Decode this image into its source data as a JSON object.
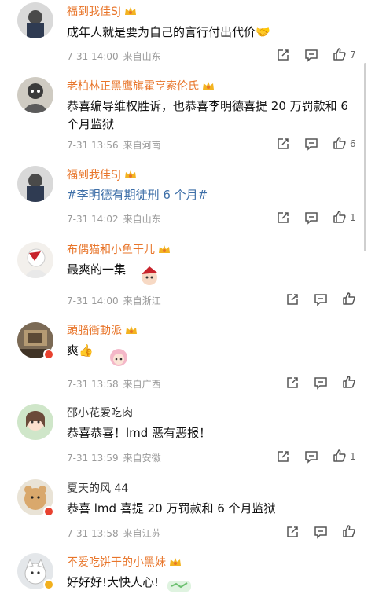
{
  "comments": [
    {
      "name": "福到我佳SJ",
      "text": "成年人就是要为自己的言行付出代价",
      "time": "7-31 14:00",
      "location": "来自山东",
      "likes": "7"
    },
    {
      "name": "老柏林正黑鹰旗霍亨索伦氏",
      "text": "恭喜编导维权胜诉，也恭喜李明德喜提 20 万罚款和 6 个月监狱",
      "time": "7-31 13:56",
      "location": "来自河南",
      "likes": "6"
    },
    {
      "name": "福到我佳SJ",
      "text": "#李明德有期徒刑 6 个月#",
      "time": "7-31 14:02",
      "location": "来自山东",
      "likes": "1"
    },
    {
      "name": "布偶猫和小鱼干儿",
      "text": "最爽的一集",
      "time": "7-31 14:00",
      "location": "来自浙江",
      "likes": ""
    },
    {
      "name": "頭腦衝動派",
      "text": "爽",
      "time": "7-31 13:58",
      "location": "来自广西",
      "likes": ""
    },
    {
      "name": "邵小花爱吃肉",
      "text": "恭喜恭喜！lmd 恶有恶报！",
      "time": "7-31 13:59",
      "location": "来自安徽",
      "likes": "1"
    },
    {
      "name": "夏天的风 44",
      "text": "恭喜 lmd 喜提 20 万罚款和 6 个月监狱",
      "time": "7-31 13:58",
      "location": "来自江苏",
      "likes": ""
    },
    {
      "name": "不爱吃饼干的小黑妹",
      "text": "好好好!大快人心!",
      "time": "",
      "location": "",
      "likes": ""
    }
  ],
  "colors": {
    "name_vip": "#e8752a",
    "name_plain": "#333333",
    "topic": "#3e6fa8",
    "meta": "#9a9a9a"
  },
  "icons": [
    "crown-icon",
    "share-icon",
    "comment-icon",
    "like-icon",
    "verified-badge-icon"
  ]
}
